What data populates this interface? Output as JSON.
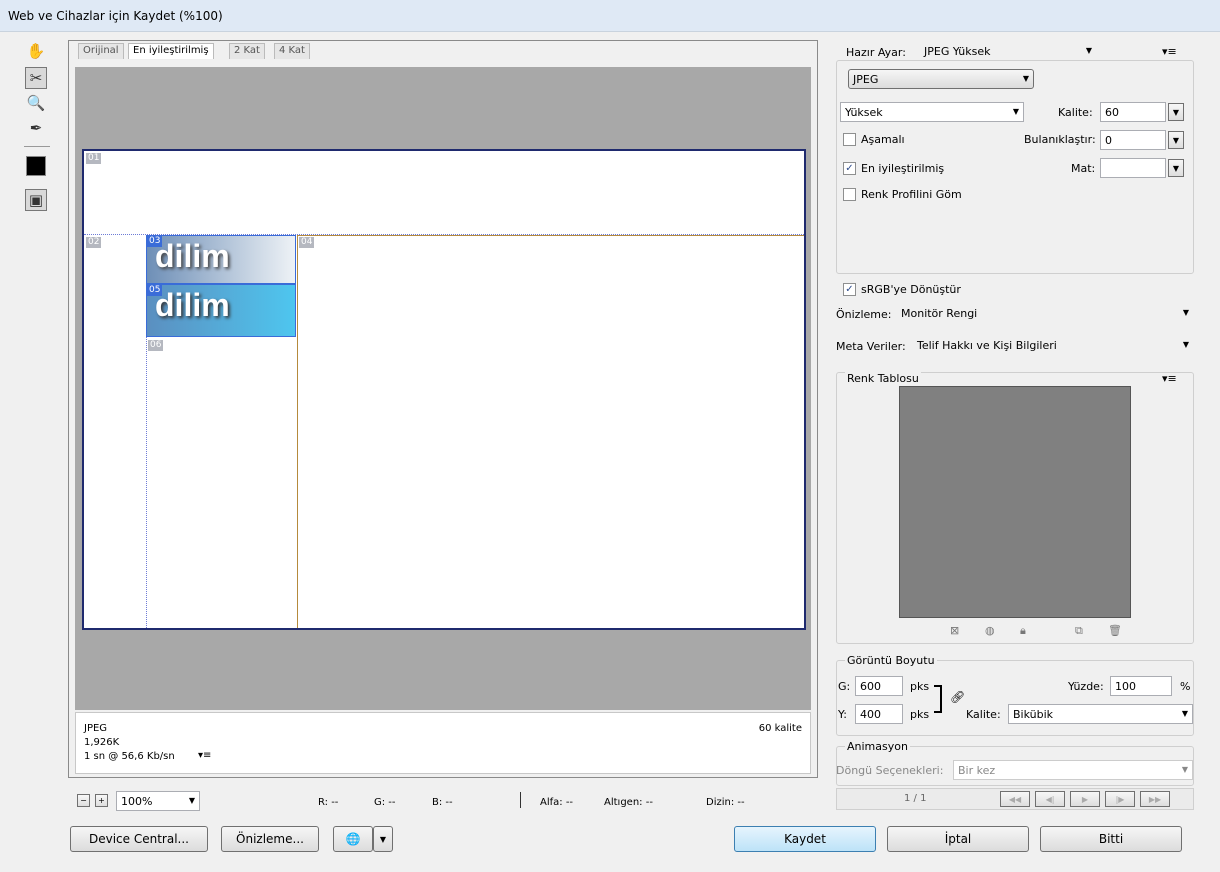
{
  "window": {
    "title": "Web ve Cihazlar için Kaydet (%100)"
  },
  "tools": [
    {
      "icon": "hand-icon",
      "glyph": "✋"
    },
    {
      "icon": "slice-select-icon",
      "glyph": "✂"
    },
    {
      "icon": "zoom-icon",
      "glyph": "🔍"
    },
    {
      "icon": "eyedropper-icon",
      "glyph": "✒"
    },
    {
      "icon": "color-swatch-icon",
      "glyph": ""
    },
    {
      "icon": "toggle-slices-icon",
      "glyph": "▣"
    }
  ],
  "tabs": [
    "Orijinal",
    "En iyileştirilmiş",
    "2 Kat",
    "4 Kat"
  ],
  "active_tab": "En iyileştirilmiş",
  "slices": [
    "01",
    "02",
    "03",
    "04",
    "05",
    "06"
  ],
  "preview_text": [
    "dilim",
    "dilim"
  ],
  "info": {
    "format": "JPEG",
    "size": "1,926K",
    "time": "1 sn @ 56,6 Kb/sn",
    "quality": "60 kalite"
  },
  "zoom": {
    "value": "100%"
  },
  "status": {
    "r": "R: --",
    "g": "G: --",
    "b": "B: --",
    "alpha": "Alfa: --",
    "hex": "Altıgen: --",
    "index": "Dizin: --"
  },
  "buttons": {
    "device_central": "Device Central...",
    "preview": "Önizleme...",
    "save": "Kaydet",
    "cancel": "İptal",
    "done": "Bitti"
  },
  "settings": {
    "preset_label": "Hazır Ayar:",
    "preset_value": "JPEG Yüksek",
    "format": "JPEG",
    "quality_level": "Yüksek",
    "quality_label": "Kalite:",
    "quality_value": "60",
    "progressive": "Aşamalı",
    "blur_label": "Bulanıklaştır:",
    "blur_value": "0",
    "optimized": "En iyileştirilmiş",
    "matte_label": "Mat:",
    "embed_profile": "Renk Profilini Göm",
    "srgb": "sRGB'ye Dönüştür",
    "preview_label": "Önizleme:",
    "preview_value": "Monitör Rengi",
    "meta_label": "Meta Veriler:",
    "meta_value": "Telif Hakkı ve Kişi Bilgileri"
  },
  "color_table": {
    "title": "Renk Tablosu",
    "swatch_color": "#808080"
  },
  "image_size": {
    "title": "Görüntü Boyutu",
    "w_label": "G:",
    "w_value": "600",
    "h_label": "Y:",
    "h_value": "400",
    "unit": "pks",
    "percent_label": "Yüzde:",
    "percent_value": "100",
    "percent_unit": "%",
    "quality_label": "Kalite:",
    "quality_value": "Bikübik"
  },
  "animation": {
    "title": "Animasyon",
    "loop_label": "Döngü Seçenekleri:",
    "loop_value": "Bir kez",
    "frame": "1 / 1"
  }
}
